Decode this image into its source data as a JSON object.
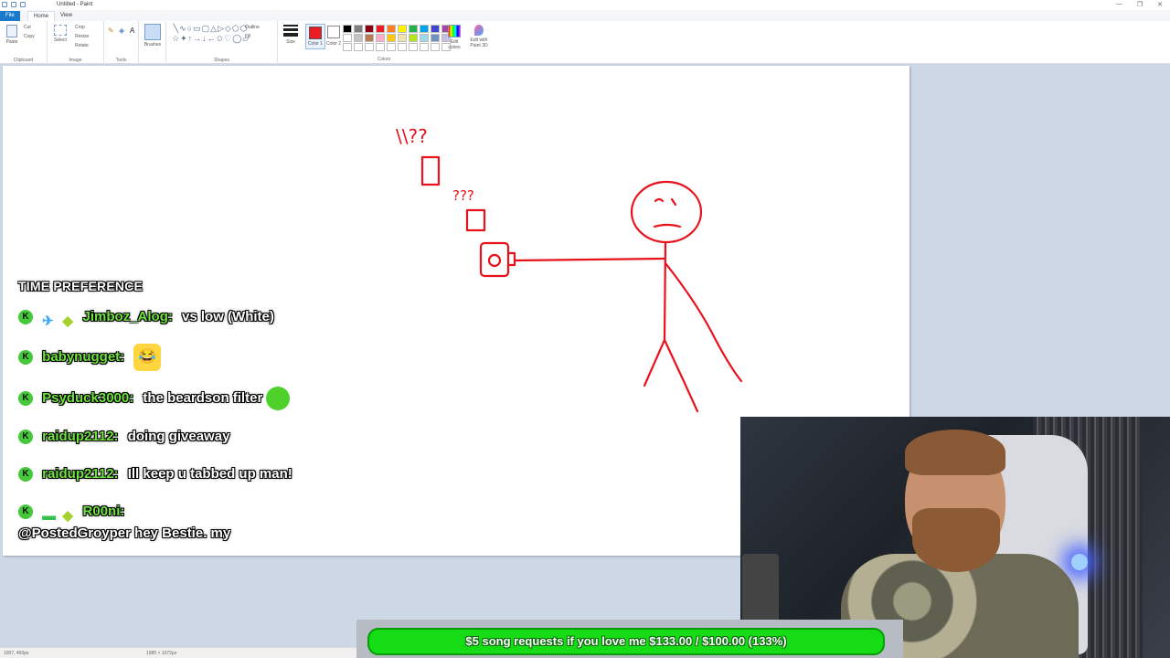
{
  "window": {
    "title": "Untitled - Paint",
    "controls": [
      "—",
      "❐",
      "✕"
    ]
  },
  "ribbon": {
    "tabs": [
      "File",
      "Home",
      "View"
    ],
    "clipboard": {
      "paste": "Paste",
      "cut": "Cut",
      "copy": "Copy",
      "label": "Clipboard"
    },
    "image": {
      "select": "Select",
      "crop": "Crop",
      "resize": "Resize",
      "rotate": "Rotate",
      "label": "Image"
    },
    "tools": {
      "brushes": "Brushes",
      "label": "Tools"
    },
    "shapes": {
      "outline": "Outline",
      "fill": "Fill",
      "label": "Shapes"
    },
    "size": {
      "label": "Size"
    },
    "colors": {
      "color1": "Color 1",
      "color2": "Color 2",
      "edit_colors": "Edit colors",
      "edit_3d": "Edit with Paint 3D",
      "label": "Colors",
      "palette": [
        "#000000",
        "#7f7f7f",
        "#880015",
        "#ed1c24",
        "#ff7f27",
        "#fff200",
        "#22b14c",
        "#00a2e8",
        "#3f48cc",
        "#a349a4",
        "#ffffff",
        "#c3c3c3",
        "#b97a57",
        "#ffaec9",
        "#ffc90e",
        "#efe4b0",
        "#b5e61d",
        "#99d9ea",
        "#7092be",
        "#c8bfe7",
        "#ffffff",
        "#ffffff",
        "#ffffff",
        "#ffffff",
        "#ffffff",
        "#ffffff",
        "#ffffff",
        "#ffffff",
        "#ffffff",
        "#ffffff"
      ]
    }
  },
  "status": {
    "cursor": "1007, 460px",
    "canvas_size": "1985 × 1072px"
  },
  "chat": {
    "header": "TIME PREFERENCE",
    "messages": [
      {
        "user": "Jimboz_Alog:",
        "text": "vs low (White)",
        "emote": ""
      },
      {
        "user": "babynugget:",
        "text": "",
        "emote": "laugh"
      },
      {
        "user": "Psyduck3000:",
        "text": "the beardson filter",
        "emote": "frog"
      },
      {
        "user": "raidup2112:",
        "text": "doing giveaway",
        "emote": ""
      },
      {
        "user": "raidup2112:",
        "text": "Ill keep u tabbed up man!",
        "emote": ""
      },
      {
        "user": "R00ni:",
        "text": "@PostedGroyper hey Bestie. my",
        "emote": ""
      }
    ]
  },
  "goal": {
    "text": "$5 song requests if you love me $133.00 / $100.00 (133%)",
    "current": 133.0,
    "target": 100.0
  },
  "drawing": {
    "ink_color": "#e8111c",
    "marks": [
      "\\\\??",
      "???"
    ]
  }
}
